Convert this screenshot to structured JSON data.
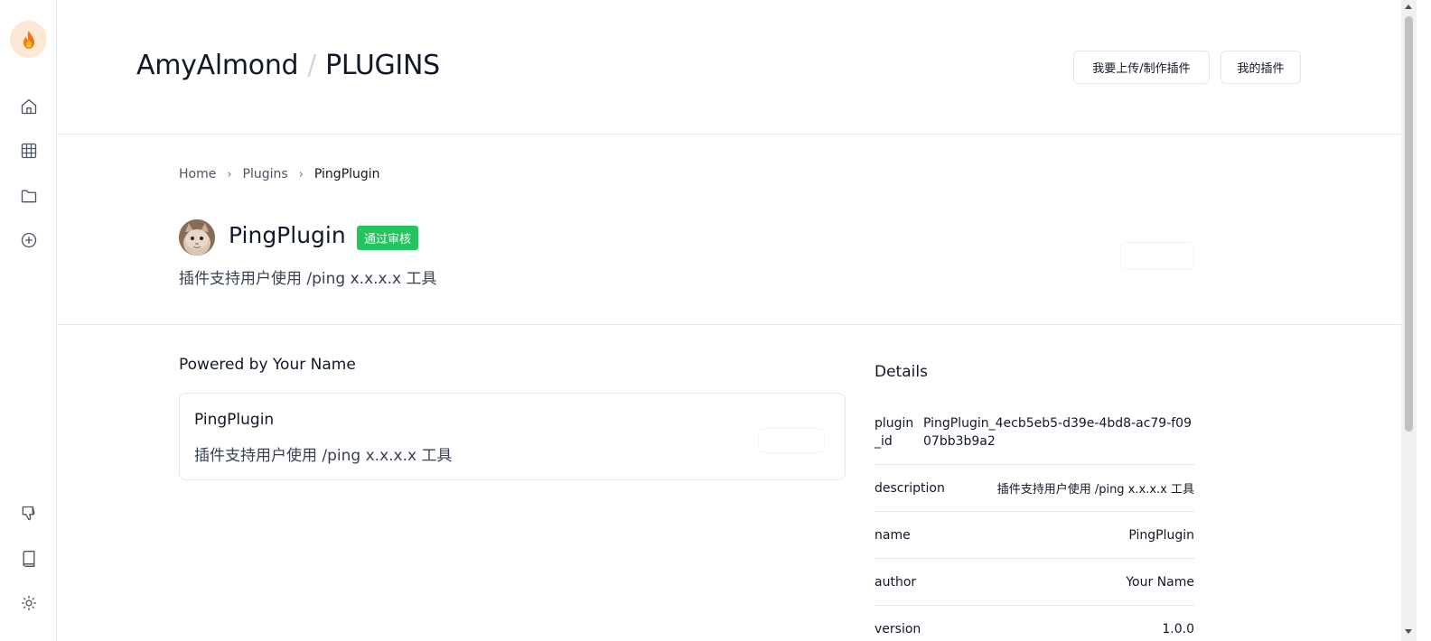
{
  "header": {
    "owner": "AmyAlmond",
    "separator": "/",
    "section": "PLUGINS",
    "buttons": {
      "upload": "我要上传/制作插件",
      "mine": "我的插件"
    }
  },
  "sidebar": {
    "logo": "flame-icon",
    "top_icons": [
      "home-icon",
      "grid-icon",
      "folder-icon",
      "plus-circle-icon"
    ],
    "bottom_icons": [
      "thumbs-down-icon",
      "book-icon",
      "sun-icon"
    ]
  },
  "breadcrumb": {
    "items": [
      "Home",
      "Plugins",
      "PingPlugin"
    ]
  },
  "plugin": {
    "name": "PingPlugin",
    "badge": "通过审核",
    "badge_color": "#22c55e",
    "description": "插件支持用户使用 /ping x.x.x.x 工具"
  },
  "powered_by": "Powered by Your Name",
  "card": {
    "title": "PingPlugin",
    "description": "插件支持用户使用 /ping x.x.x.x 工具"
  },
  "details": {
    "title": "Details",
    "rows": [
      {
        "key": "plugin_id",
        "value": "PingPlugin_4ecb5eb5-d39e-4bd8-ac79-f0907bb3b9a2"
      },
      {
        "key": "description",
        "value": "插件支持用户使用 /ping x.x.x.x 工具"
      },
      {
        "key": "name",
        "value": "PingPlugin"
      },
      {
        "key": "author",
        "value": "Your Name"
      },
      {
        "key": "version",
        "value": "1.0.0"
      }
    ]
  }
}
